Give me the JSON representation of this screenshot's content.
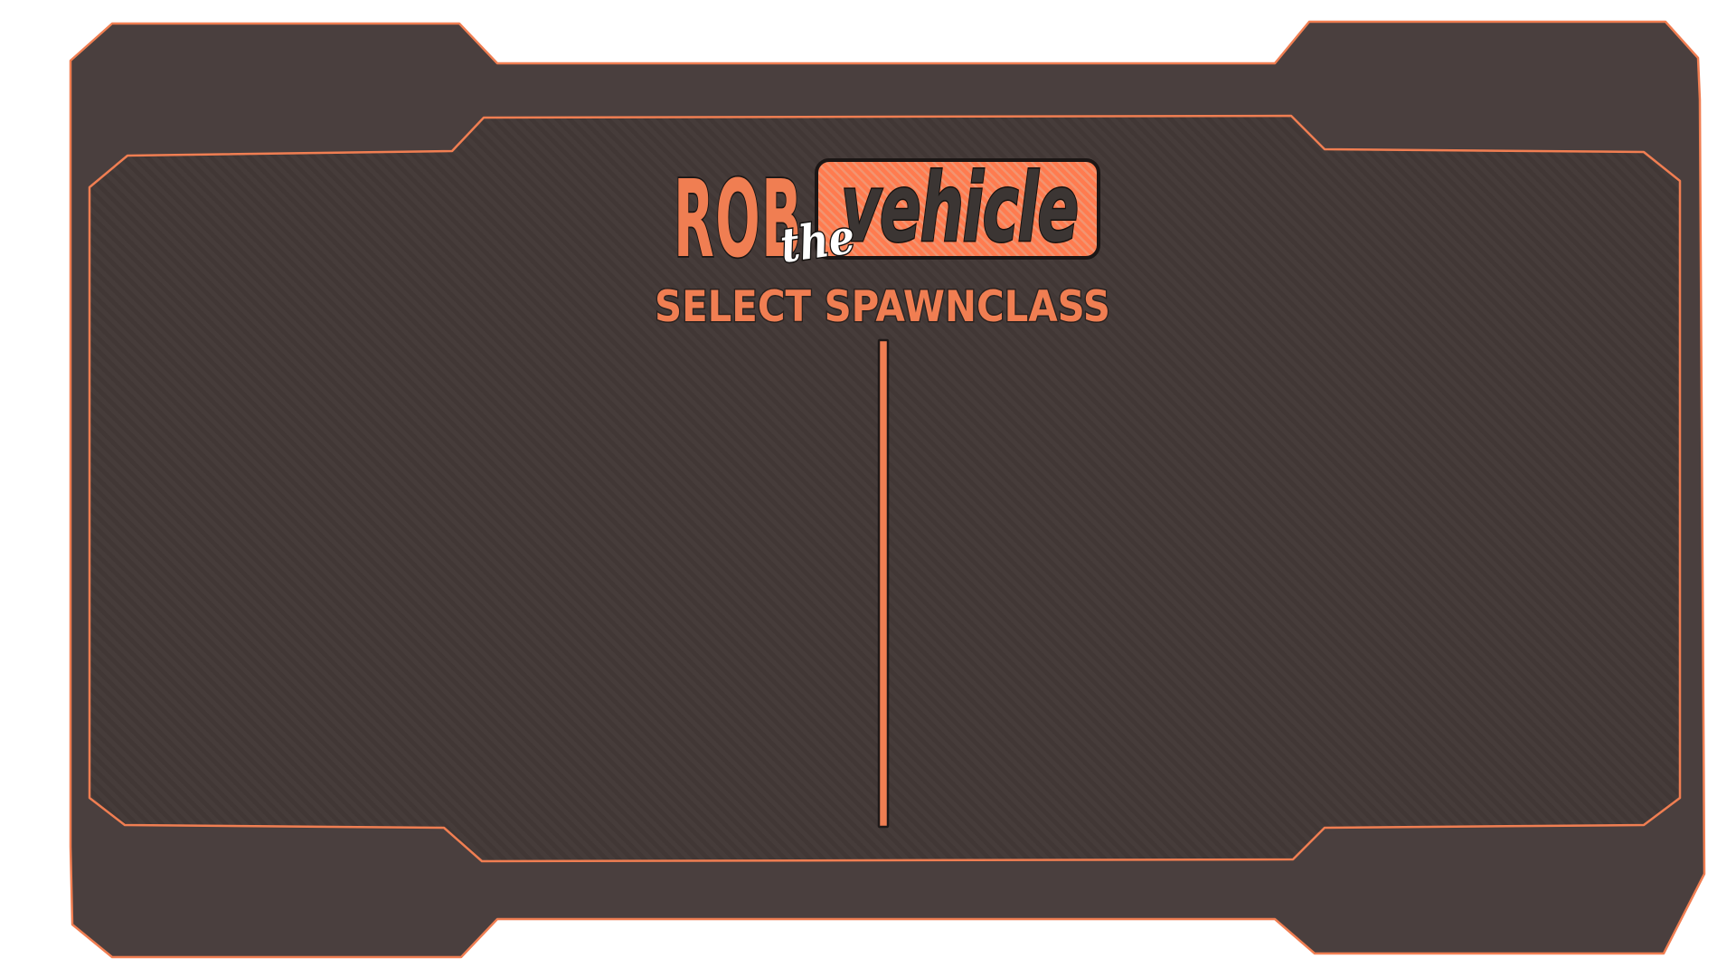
{
  "logo": {
    "word_rob": "ROB",
    "word_the": "the",
    "word_vehicle": "vehicle"
  },
  "screen": {
    "title": "SELECT SPAWNCLASS"
  },
  "colors": {
    "accent": "#f07e52",
    "frame_fill": "#4a3f3e",
    "panel_fill": "#463c3a",
    "logo_badge": "#ff7b4f",
    "page_background": "#ffffff"
  },
  "spawn_classes": {
    "left_column": [],
    "right_column": []
  }
}
